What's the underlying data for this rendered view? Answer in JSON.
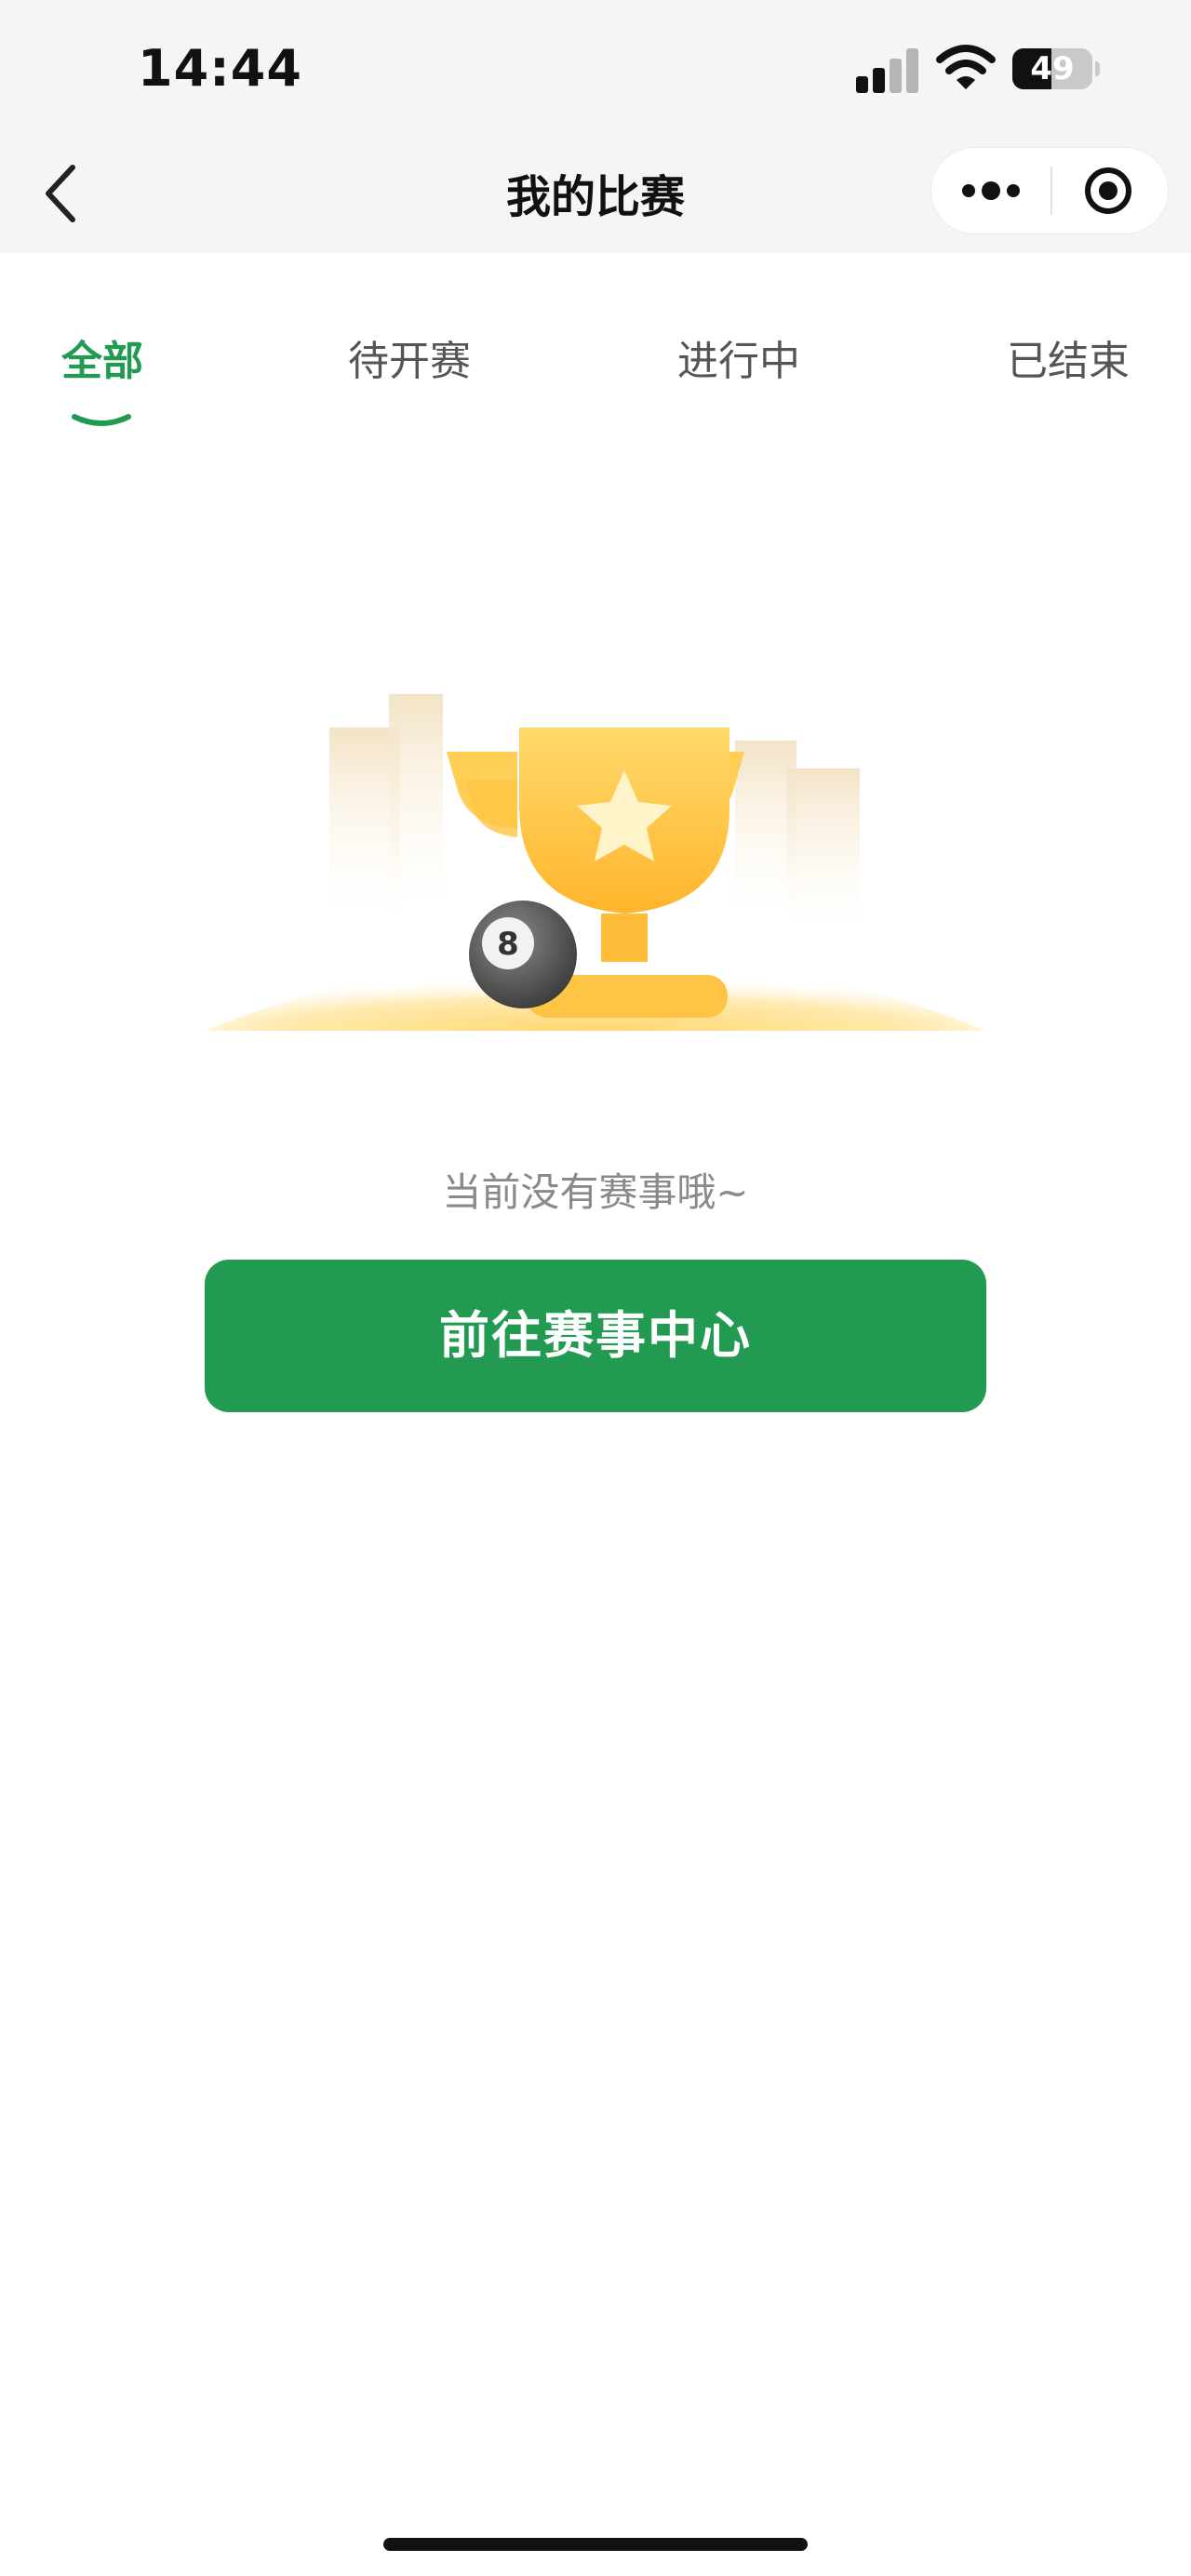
{
  "status_bar": {
    "time": "14:44",
    "battery_level": "49",
    "battery_fraction": 0.49,
    "signal_bars_active": 2,
    "signal_bars_total": 4,
    "icons": [
      "cellular-signal-icon",
      "wifi-icon",
      "battery-icon"
    ]
  },
  "nav": {
    "title": "我的比赛",
    "back_icon": "chevron-left-icon",
    "more_icon": "more-dots-icon",
    "close_icon": "target-circle-icon"
  },
  "tabs": [
    {
      "label": "全部",
      "active": true
    },
    {
      "label": "待开赛",
      "active": false
    },
    {
      "label": "进行中",
      "active": false
    },
    {
      "label": "已结束",
      "active": false
    }
  ],
  "illustration": {
    "icon": "trophy-with-8-ball-icon",
    "ball_number": "8"
  },
  "empty_state": {
    "message": "当前没有赛事哦~",
    "button_label": "前往赛事中心"
  },
  "colors": {
    "accent": "#229a52",
    "tab_inactive": "#555555",
    "muted_text": "#8a8a8a",
    "trophy": "#ffc94a",
    "header_bg": "#f5f5f5"
  }
}
